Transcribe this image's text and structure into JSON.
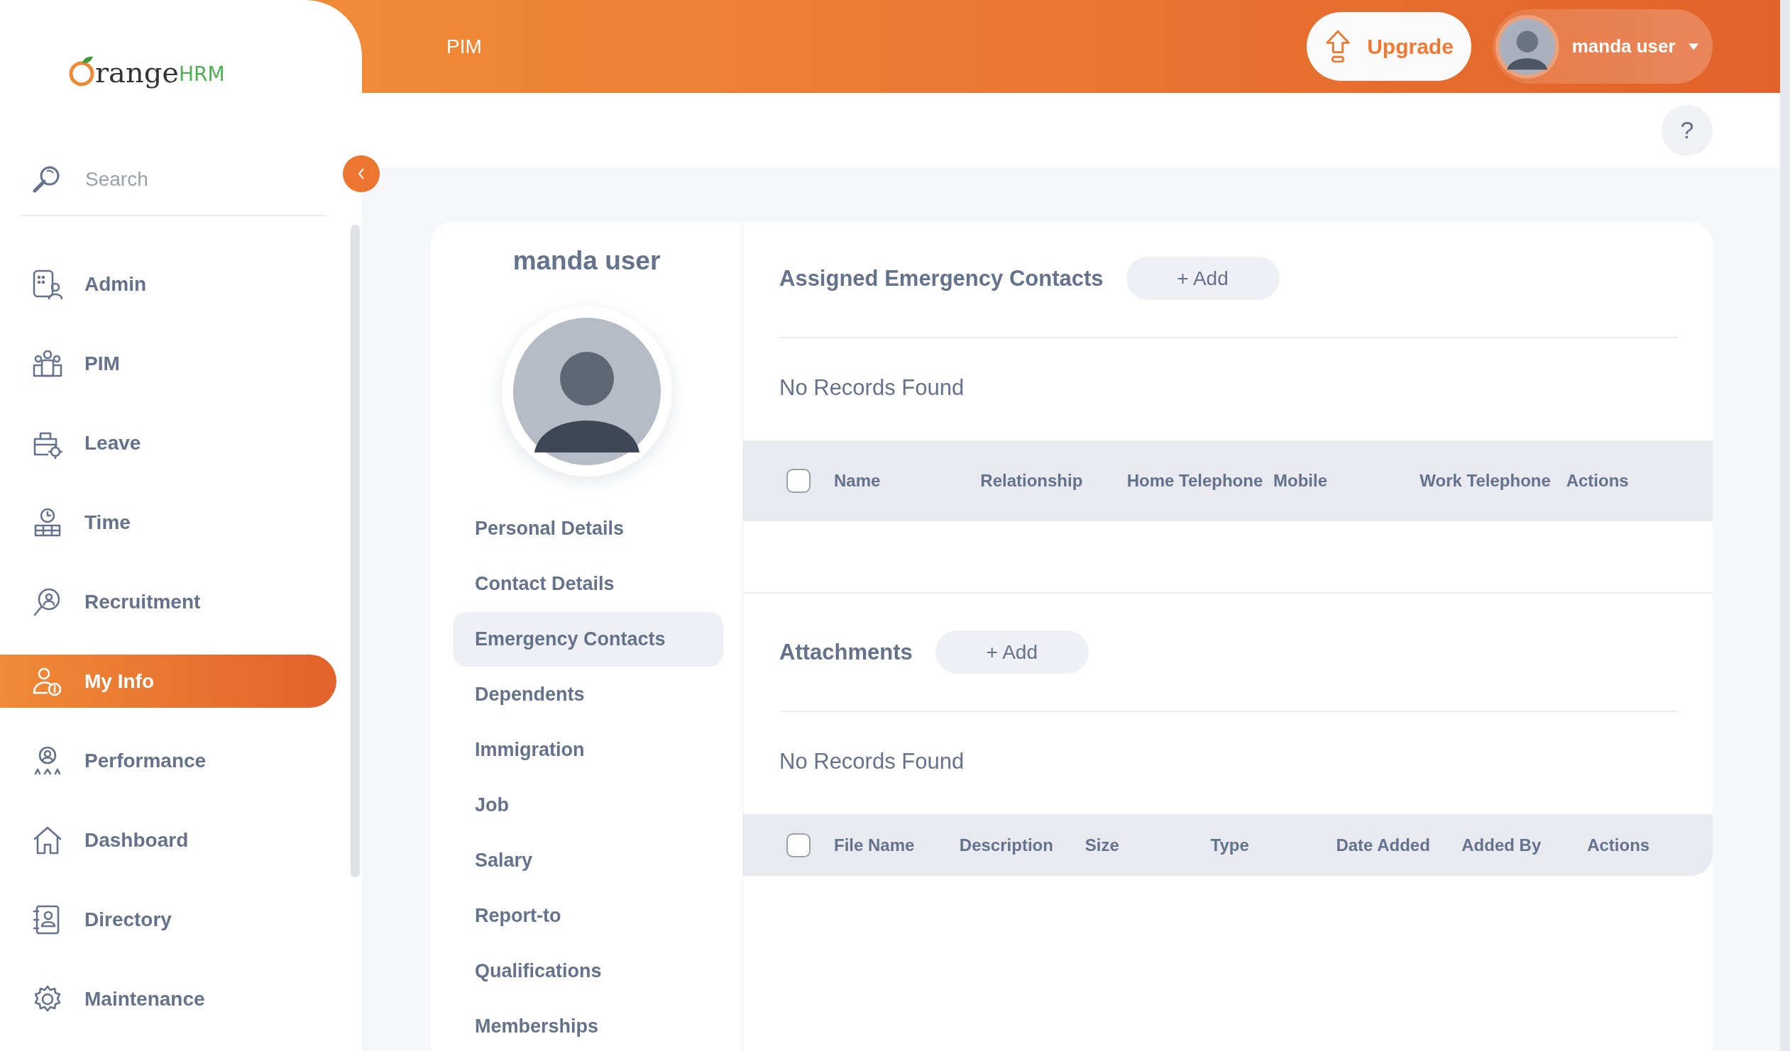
{
  "sidebar": {
    "logo": {
      "text": "range",
      "accent": "HRM"
    },
    "search": {
      "placeholder": "Search"
    },
    "items": [
      {
        "label": "Admin",
        "kind": "admin",
        "selected": false
      },
      {
        "label": "PIM",
        "kind": "pim",
        "selected": false
      },
      {
        "label": "Leave",
        "kind": "leave",
        "selected": false
      },
      {
        "label": "Time",
        "kind": "time",
        "selected": false
      },
      {
        "label": "Recruitment",
        "kind": "recruitment",
        "selected": false
      },
      {
        "label": "My Info",
        "kind": "myinfo",
        "selected": true
      },
      {
        "label": "Performance",
        "kind": "performance",
        "selected": false
      },
      {
        "label": "Dashboard",
        "kind": "dashboard",
        "selected": false
      },
      {
        "label": "Directory",
        "kind": "directory",
        "selected": false
      },
      {
        "label": "Maintenance",
        "kind": "maintenance",
        "selected": false
      }
    ]
  },
  "header": {
    "title": "PIM",
    "upgrade_button": "Upgrade",
    "user_menu": {
      "name": "manda user"
    },
    "help_button": "?"
  },
  "profile": {
    "name": "manda user",
    "menu": [
      {
        "label": "Personal Details",
        "selected": false
      },
      {
        "label": "Contact Details",
        "selected": false
      },
      {
        "label": "Emergency Contacts",
        "selected": true
      },
      {
        "label": "Dependents",
        "selected": false
      },
      {
        "label": "Immigration",
        "selected": false
      },
      {
        "label": "Job",
        "selected": false
      },
      {
        "label": "Salary",
        "selected": false
      },
      {
        "label": "Report-to",
        "selected": false
      },
      {
        "label": "Qualifications",
        "selected": false
      },
      {
        "label": "Memberships",
        "selected": false
      }
    ]
  },
  "sections": [
    {
      "title": "Assigned Emergency Contacts",
      "add_button": "+ Add",
      "empty_message": "No Records Found",
      "select_all": {
        "checked": false
      },
      "columns": [
        "Name",
        "Relationship",
        "Home Telephone",
        "Mobile",
        "Work Telephone",
        "Actions"
      ]
    },
    {
      "title": "Attachments",
      "add_button": "+ Add",
      "empty_message": "No Records Found",
      "select_all": {
        "checked": false
      },
      "columns": [
        "File Name",
        "Description",
        "Size",
        "Type",
        "Date Added",
        "Added By",
        "Actions"
      ]
    }
  ]
}
